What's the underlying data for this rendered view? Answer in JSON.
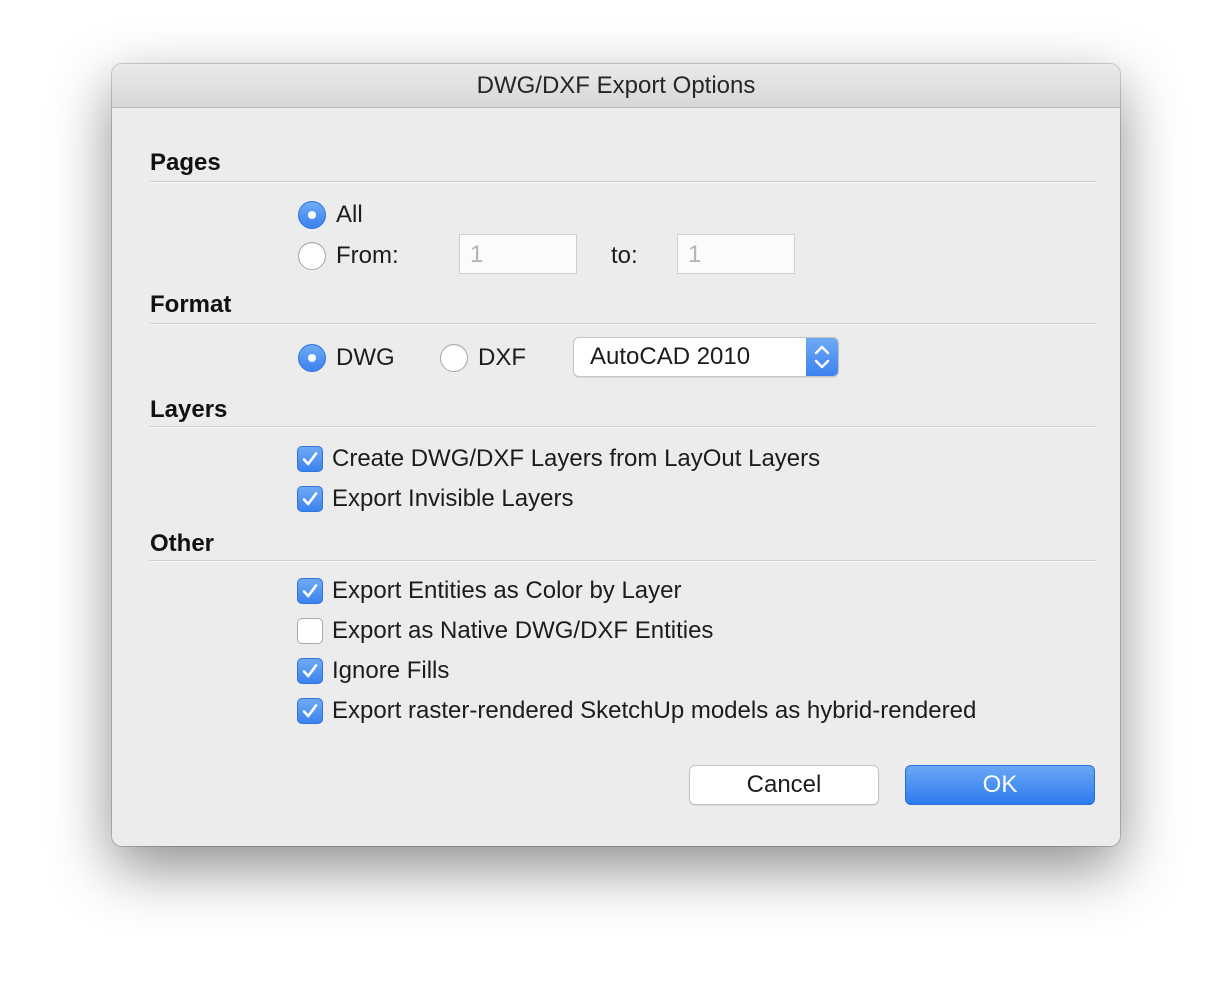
{
  "dialog": {
    "title": "DWG/DXF Export Options"
  },
  "pages": {
    "heading": "Pages",
    "all_label": "All",
    "from_label": "From:",
    "from_value": "1",
    "to_label": "to:",
    "to_value": "1",
    "selected": "All"
  },
  "format": {
    "heading": "Format",
    "dwg_label": "DWG",
    "dxf_label": "DXF",
    "selected": "DWG",
    "version_value": "AutoCAD 2010"
  },
  "layers": {
    "heading": "Layers",
    "create_layers": {
      "label": "Create DWG/DXF Layers from LayOut Layers",
      "checked": true
    },
    "export_invisible": {
      "label": "Export Invisible Layers",
      "checked": true
    }
  },
  "other": {
    "heading": "Other",
    "color_by_layer": {
      "label": "Export Entities as Color by Layer",
      "checked": true
    },
    "native_entities": {
      "label": "Export as Native DWG/DXF Entities",
      "checked": false
    },
    "ignore_fills": {
      "label": "Ignore Fills",
      "checked": true
    },
    "hybrid_rendered": {
      "label": "Export raster-rendered SketchUp models as hybrid-rendered",
      "checked": true
    }
  },
  "buttons": {
    "cancel_label": "Cancel",
    "ok_label": "OK"
  },
  "colors": {
    "accent": "#3b82ee",
    "window_bg": "#ececec"
  }
}
